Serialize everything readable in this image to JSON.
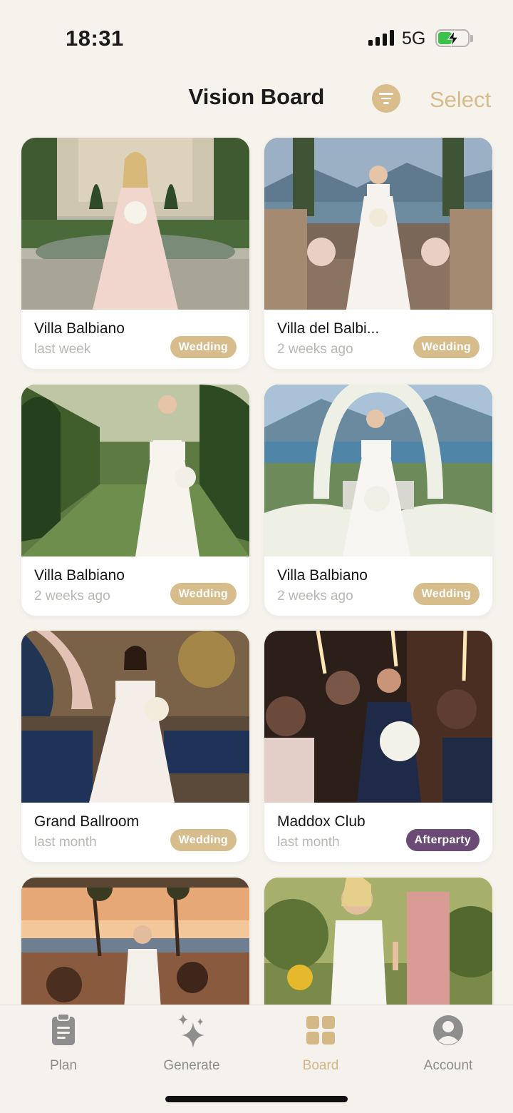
{
  "status_bar": {
    "time": "18:31",
    "network": "5G",
    "icons": [
      "signal-icon",
      "battery-charging-icon"
    ]
  },
  "header": {
    "title": "Vision Board",
    "filter_icon": "filter-lines-icon",
    "select_label": "Select"
  },
  "colors": {
    "accent": "#d8bd8c",
    "afterparty": "#6b4a75",
    "background": "#f6f2ec"
  },
  "cards": [
    {
      "title": "Villa Balbiano",
      "date": "last week",
      "tag": "Wedding",
      "image": "bride-in-garden-photo"
    },
    {
      "title": "Villa del Balbi...",
      "date": "2 weeks ago",
      "tag": "Wedding",
      "image": "bride-on-candlelit-stairs-photo"
    },
    {
      "title": "Villa Balbiano",
      "date": "2 weeks ago",
      "tag": "Wedding",
      "image": "bride-in-hedge-garden-photo"
    },
    {
      "title": "Villa Balbiano",
      "date": "2 weeks ago",
      "tag": "Wedding",
      "image": "bride-under-flower-arch-photo"
    },
    {
      "title": "Grand Ballroom",
      "date": "last month",
      "tag": "Wedding",
      "image": "bride-in-ballroom-photo"
    },
    {
      "title": "Maddox Club",
      "date": "last month",
      "tag": "Afterparty",
      "image": "sparkler-club-party-photo"
    },
    {
      "image": "sunset-terrace-party-photo"
    },
    {
      "image": "vineyard-toast-photo"
    }
  ],
  "tab_bar": {
    "tabs": [
      {
        "label": "Plan",
        "icon": "clipboard-icon"
      },
      {
        "label": "Generate",
        "icon": "sparkles-icon"
      },
      {
        "label": "Board",
        "icon": "grid-icon"
      },
      {
        "label": "Account",
        "icon": "person-circle-icon"
      }
    ],
    "active": "Board"
  }
}
